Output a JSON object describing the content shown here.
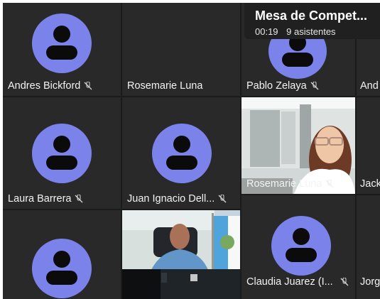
{
  "meeting": {
    "title": "Mesa de Compet...",
    "duration": "00:19",
    "attendees": "9 asistentes"
  },
  "participants": {
    "andres": {
      "name": "Andres Bickford",
      "muted": true
    },
    "rosemarie_top": {
      "name": "Rosemarie Luna",
      "muted": false
    },
    "pablo": {
      "name": "Pablo Zelaya",
      "muted": true
    },
    "andr_partial": {
      "name": "And",
      "muted": false
    },
    "laura": {
      "name": "Laura Barrera",
      "muted": true
    },
    "juan": {
      "name": "Juan Ignacio Dell...",
      "muted": true
    },
    "rosemarie_video": {
      "name": "Rosemarie Luna",
      "muted": true
    },
    "jack_partial": {
      "name": "Jack",
      "muted": false
    },
    "claudia": {
      "name": "Claudia Juarez (I...",
      "muted": true
    },
    "jorg_partial": {
      "name": "Jorg",
      "muted": false
    }
  },
  "colors": {
    "avatar": "#7b83eb",
    "tile": "#292929",
    "panel": "#202020"
  }
}
